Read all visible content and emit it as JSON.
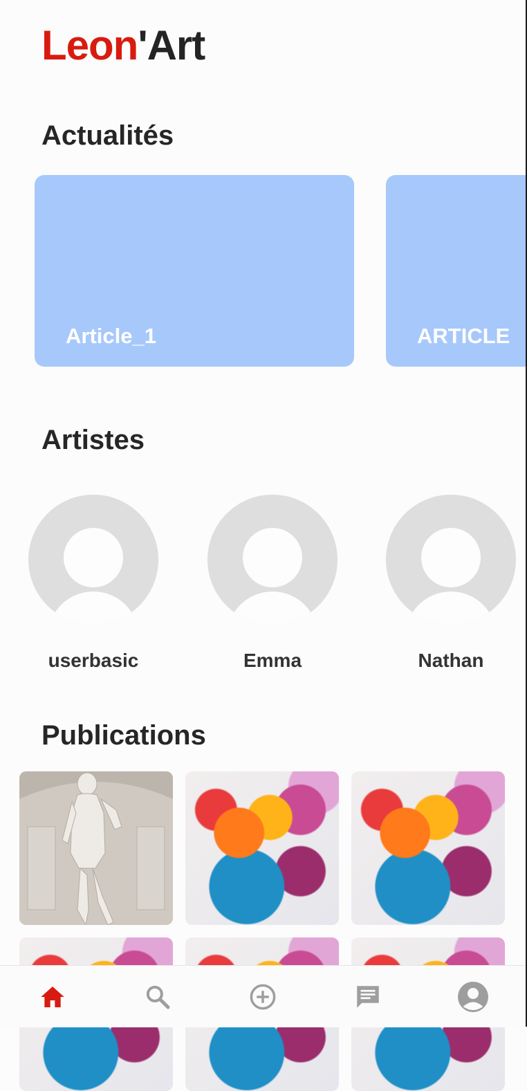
{
  "app": {
    "logo_part1": "Leon'",
    "logo_part1_display": "Leon",
    "logo_part2": "'Art",
    "brand_color": "#d81b10"
  },
  "sections": {
    "news_title": "Actualités",
    "artists_title": "Artistes",
    "publications_title": "Publications"
  },
  "news": [
    {
      "label": "Article_1"
    },
    {
      "label": "ARTICLE"
    }
  ],
  "artists": [
    {
      "name": "userbasic"
    },
    {
      "name": "Emma"
    },
    {
      "name": "Nathan"
    }
  ],
  "publications": [
    {
      "image": "statue-photo"
    },
    {
      "image": "paint-splash"
    },
    {
      "image": "paint-splash"
    },
    {
      "image": "paint-splash"
    },
    {
      "image": "paint-splash"
    },
    {
      "image": "paint-splash"
    }
  ],
  "nav": {
    "items": [
      "home-icon",
      "search-icon",
      "add-circle-icon",
      "chat-icon",
      "account-icon"
    ],
    "active": "home-icon",
    "active_color": "#d81b10",
    "inactive_color": "#9e9e9e"
  }
}
